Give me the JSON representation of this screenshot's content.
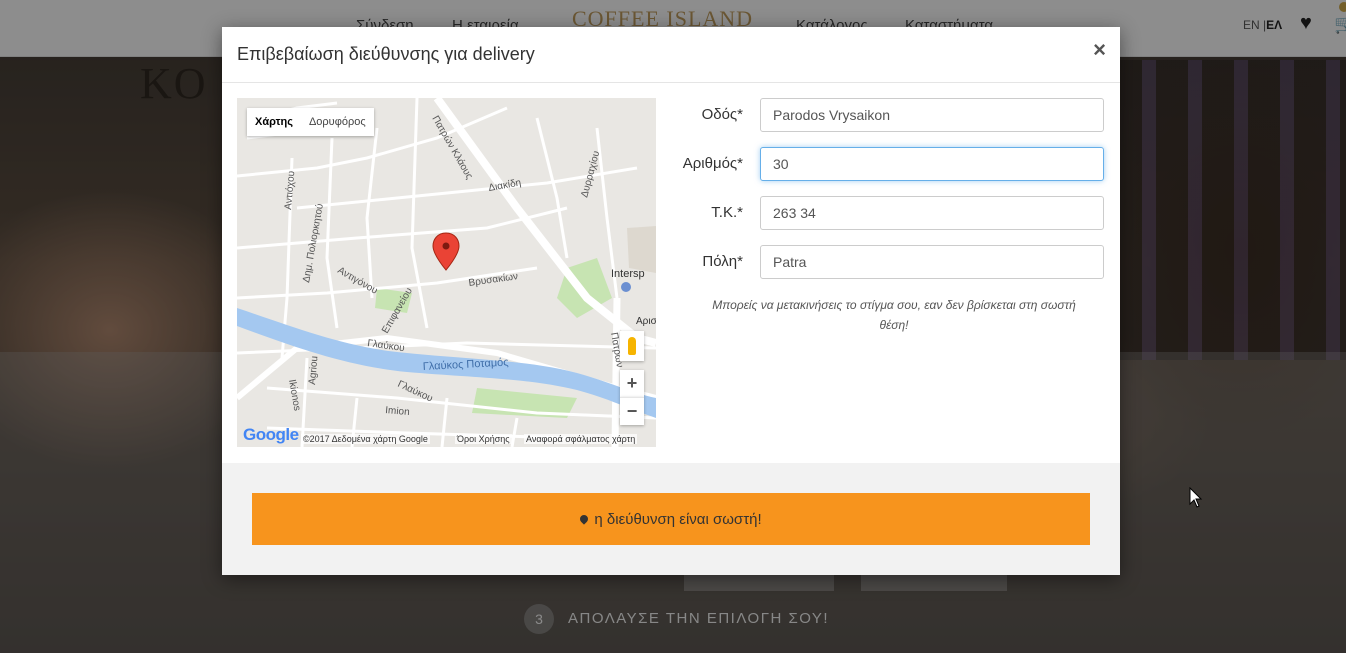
{
  "background": {
    "nav": {
      "links": [
        "Σύνδεση",
        "Η εταιρεία",
        "Κατάλογος",
        "Καταστήματα"
      ],
      "logo": "COFFEE ISLAND",
      "lang_en": "EN",
      "lang_sep": " |",
      "lang_el": "ΕΛ"
    },
    "hero_text": "KO",
    "step_number": "3",
    "step_label": "ΑΠΟΛΑΥΣΕ ΤΗΝ ΕΠΙΛΟΓΗ ΣΟΥ!"
  },
  "modal": {
    "title": "Επιβεβαίωση διεύθυνσης για delivery",
    "close_label": "×",
    "map": {
      "type_map": "Χάρτης",
      "type_satellite": "Δορυφόρος",
      "zoom_in": "+",
      "zoom_out": "−",
      "logo": "Google",
      "copyright": "©2017 Δεδομένα χάρτη Google",
      "terms": "Όροι Χρήσης",
      "report": "Αναφορά σφάλματος χάρτη",
      "street_labels": [
        "Βρυσακίων",
        "Γλαύκου",
        "Γλαύκος Ποταμός",
        "Επιφανείου",
        "Αντιγόνου",
        "Δημ. Πολιορκητού",
        "Αντιόχου",
        "Πατρών Κλάους",
        "Διακίδη",
        "Δυρραχίου",
        "Imion",
        "Ikionos",
        "Agriou",
        "Γλαύκου",
        "Intersp",
        "Αριστ",
        "Πατρών"
      ]
    },
    "fields": [
      {
        "label": "Οδός*",
        "value": "Parodos Vrysaikon"
      },
      {
        "label": "Αριθμός*",
        "value": "30"
      },
      {
        "label": "Τ.Κ.*",
        "value": "263 34"
      },
      {
        "label": "Πόλη*",
        "value": "Patra"
      }
    ],
    "hint": "Μπορείς να μετακινήσεις το στίγμα σου, εαν δεν βρίσκεται στη σωστή θέση!",
    "confirm_label": "η διεύθυνση είναι σωστή!"
  },
  "colors": {
    "accent": "#f7941d",
    "focus": "#66afe9",
    "marker": "#ea4335",
    "river": "#a4c8f0",
    "park": "#c7e4b2"
  }
}
